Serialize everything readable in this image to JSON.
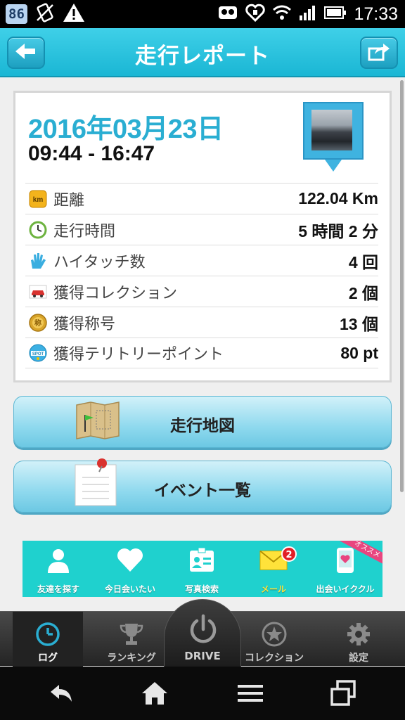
{
  "status_bar": {
    "notification_badge": "86",
    "time": "17:33",
    "icons": [
      "no-sim-icon",
      "warning-icon",
      "mask-icon",
      "heart-icon",
      "wifi-icon",
      "signal-icon",
      "battery-icon"
    ]
  },
  "header": {
    "title": "走行レポート",
    "back_icon": "back-arrow-icon",
    "share_icon": "share-icon"
  },
  "report": {
    "date": "2016年03月23日",
    "time_range": "09:44 - 16:47",
    "stats": [
      {
        "icon": "km-icon",
        "label": "距離",
        "value": "122.04 Km"
      },
      {
        "icon": "clock-icon",
        "label": "走行時間",
        "value": "5 時間 2 分"
      },
      {
        "icon": "hi-touch-icon",
        "label": "ハイタッチ数",
        "value": "4 回"
      },
      {
        "icon": "car-icon",
        "label": "獲得コレクション",
        "value": "2 個"
      },
      {
        "icon": "medal-icon",
        "label": "獲得称号",
        "value": "13 個"
      },
      {
        "icon": "spot-icon",
        "label": "獲得テリトリーポイント",
        "value": "80 pt"
      }
    ]
  },
  "buttons": {
    "map": "走行地図",
    "events": "イベント一覧"
  },
  "promo": {
    "items": [
      {
        "icon": "person-icon",
        "label": "友達を探す"
      },
      {
        "icon": "heart-icon",
        "label": "今日会いたい"
      },
      {
        "icon": "photo-id-icon",
        "label": "写真検索"
      },
      {
        "icon": "mail-icon",
        "label": "メール",
        "badge": "2"
      },
      {
        "icon": "phone-heart-icon",
        "label": "出会いイククル"
      }
    ],
    "ribbon": "オススメ"
  },
  "tabbar": {
    "items": [
      {
        "icon": "clock-icon",
        "label": "ログ",
        "active": true
      },
      {
        "icon": "trophy-icon",
        "label": "ランキング"
      },
      {
        "icon": "power-icon",
        "label": "DRIVE"
      },
      {
        "icon": "star-icon",
        "label": "コレクション"
      },
      {
        "icon": "gear-icon",
        "label": "設定"
      }
    ]
  },
  "colors": {
    "header": "#1ab6d4",
    "date": "#2aaed2",
    "promo_bg": "#1fd1ce",
    "mail_label": "#ffe23a"
  }
}
